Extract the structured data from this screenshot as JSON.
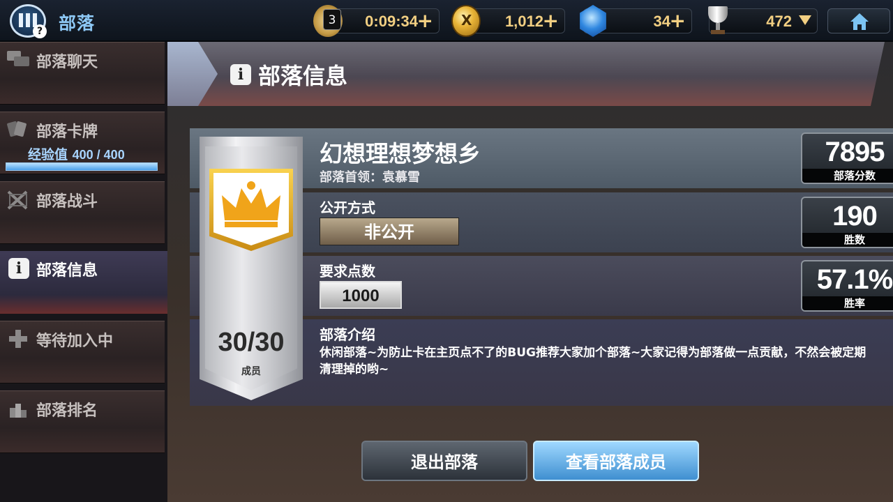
{
  "topbar": {
    "title": "部落",
    "timer": {
      "count": "3",
      "value": "0:09:34",
      "plus": "+"
    },
    "gold": {
      "symbol": "X",
      "value": "1,012",
      "plus": "+"
    },
    "gems": {
      "value": "34",
      "plus": "+"
    },
    "trophies": {
      "value": "472"
    }
  },
  "sidebar": {
    "items": [
      {
        "label": "部落聊天"
      },
      {
        "label": "部落卡牌",
        "xp_label": "经验值",
        "xp_value": "400 / 400",
        "xp_fraction": 1.0
      },
      {
        "label": "部落战斗"
      },
      {
        "label": "部落信息"
      },
      {
        "label": "等待加入中"
      },
      {
        "label": "部落排名"
      }
    ]
  },
  "header": {
    "title": "部落信息"
  },
  "clan": {
    "name": "幻想理想梦想乡",
    "leader": "部落首领：袁慕雪",
    "members": "30/30",
    "members_caption": "成员",
    "public_label": "公开方式",
    "public_value": "非公开",
    "required_label": "要求点数",
    "required_value": "1000",
    "intro_label": "部落介绍",
    "intro_text": "休闲部落~为防止卡在主页点不了的BUG推荐大家加个部落~大家记得为部落做一点贡献，不然会被定期清理掉的哟~"
  },
  "stats": [
    {
      "value": "7895",
      "caption": "部落分数"
    },
    {
      "value": "190",
      "caption": "胜数"
    },
    {
      "value": "57.1%",
      "caption": "胜率"
    }
  ],
  "buttons": {
    "exit": "退出部落",
    "view_members": "查看部落成员"
  },
  "colors": {
    "accent_blue": "#8dc8f5",
    "gold": "#f2cf82",
    "crest_gold": "#f0a41a"
  }
}
